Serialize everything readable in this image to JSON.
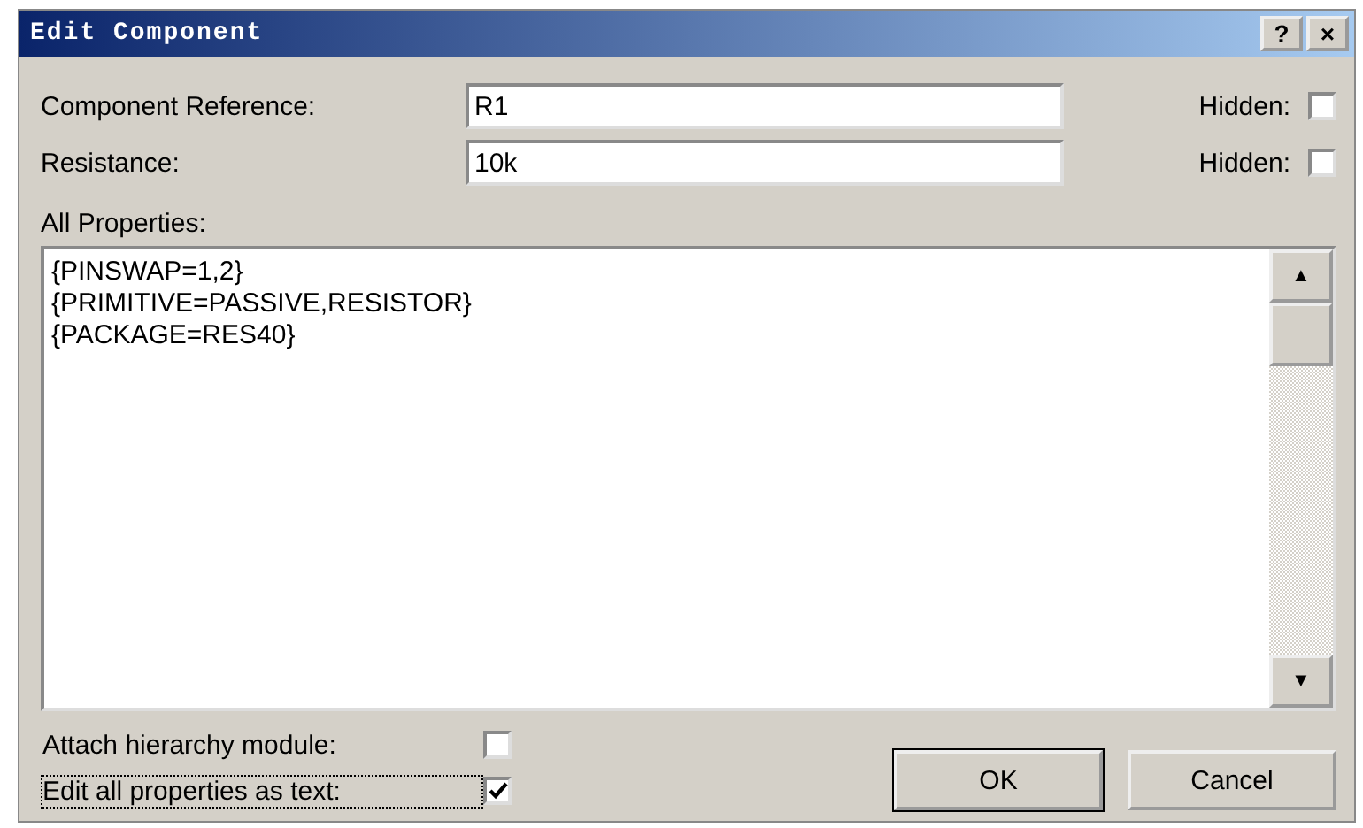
{
  "window": {
    "title": "Edit Component",
    "title_buttons": [
      "?",
      "×"
    ]
  },
  "fields": [
    {
      "label": "Component Reference:",
      "value": "R1",
      "hidden_label": "Hidden:",
      "hidden": false
    },
    {
      "label": "Resistance:",
      "value": "10k",
      "hidden_label": "Hidden:",
      "hidden": false
    }
  ],
  "properties": {
    "label": "All Properties:",
    "lines": [
      "{PINSWAP=1,2}",
      "{PRIMITIVE=PASSIVE,RESISTOR}",
      "{PACKAGE=RES40}"
    ],
    "scroll_up": "▲",
    "scroll_down": "▼"
  },
  "options": [
    {
      "label": "Attach hierarchy module:",
      "checked": false,
      "focused": false
    },
    {
      "label": "Edit all properties as text:",
      "checked": true,
      "focused": true
    }
  ],
  "buttons": [
    {
      "label": "OK",
      "default": true
    },
    {
      "label": "Cancel",
      "default": false
    }
  ]
}
